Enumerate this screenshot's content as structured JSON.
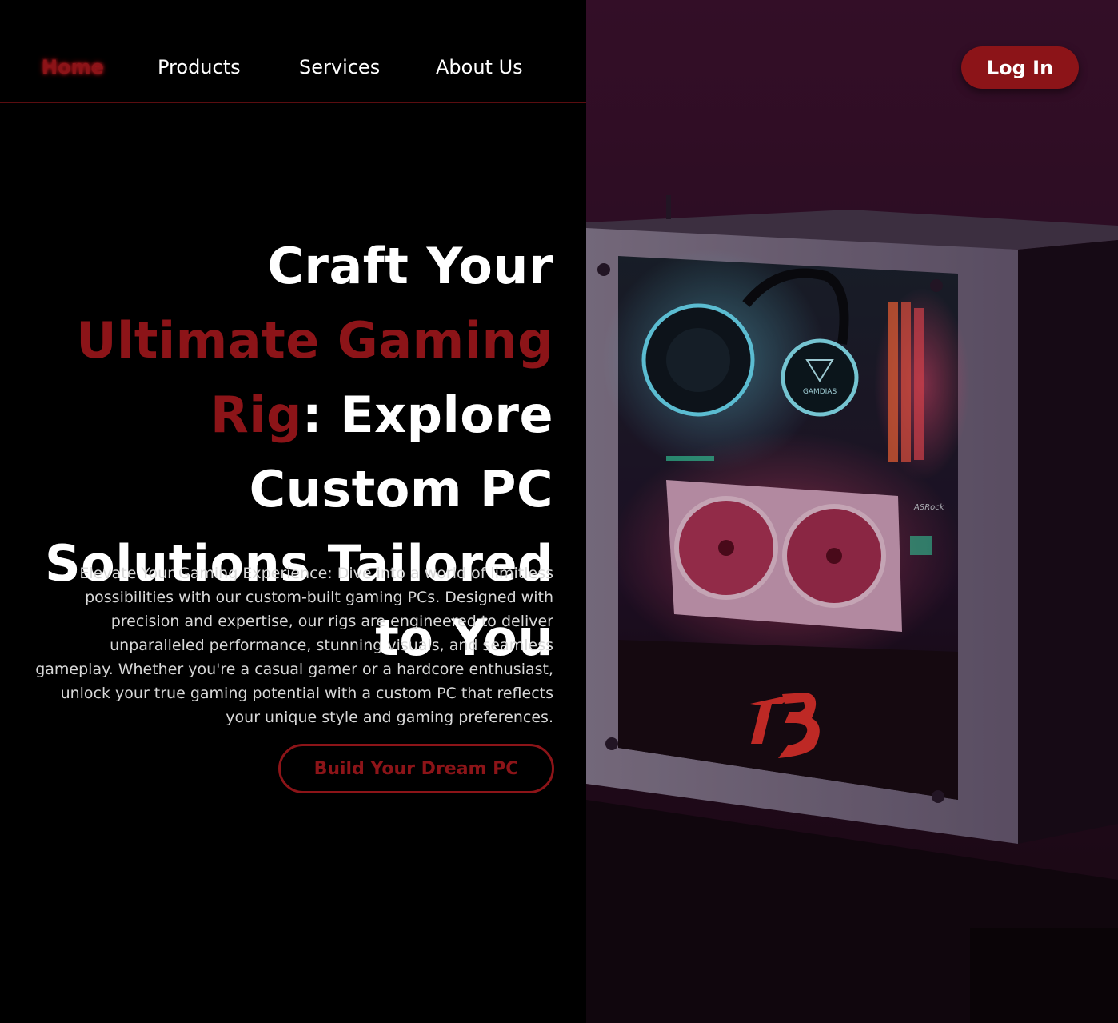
{
  "nav": {
    "items": [
      {
        "label": "Home",
        "active": true
      },
      {
        "label": "Products",
        "active": false
      },
      {
        "label": "Services",
        "active": false
      },
      {
        "label": "About Us",
        "active": false
      }
    ],
    "login_label": "Log In"
  },
  "hero": {
    "title_part1": "Craft Your ",
    "title_accent1": "Ultimate Gaming Rig",
    "title_part2": ": Explore Custom PC Solutions Tailored to You",
    "description": "Elevate Your Gaming Experience: Dive into a world of limitless possibilities with our custom-built gaming PCs. Designed with precision and expertise, our rigs are engineered to deliver unparalleled performance, stunning visuals, and seamless gameplay. Whether you're a casual gamer or a hardcore enthusiast, unlock your true gaming potential with a custom PC that reflects your unique style and gaming preferences.",
    "cta_label": "Build Your Dream PC"
  },
  "image": {
    "cooler_label": "GAMDIAS",
    "board_label": "ASRock"
  },
  "colors": {
    "accent": "#8c1418",
    "background": "#000000",
    "text": "#ffffff",
    "neon_cyan": "#6fe6ff",
    "neon_pink": "#ff4f7a"
  }
}
